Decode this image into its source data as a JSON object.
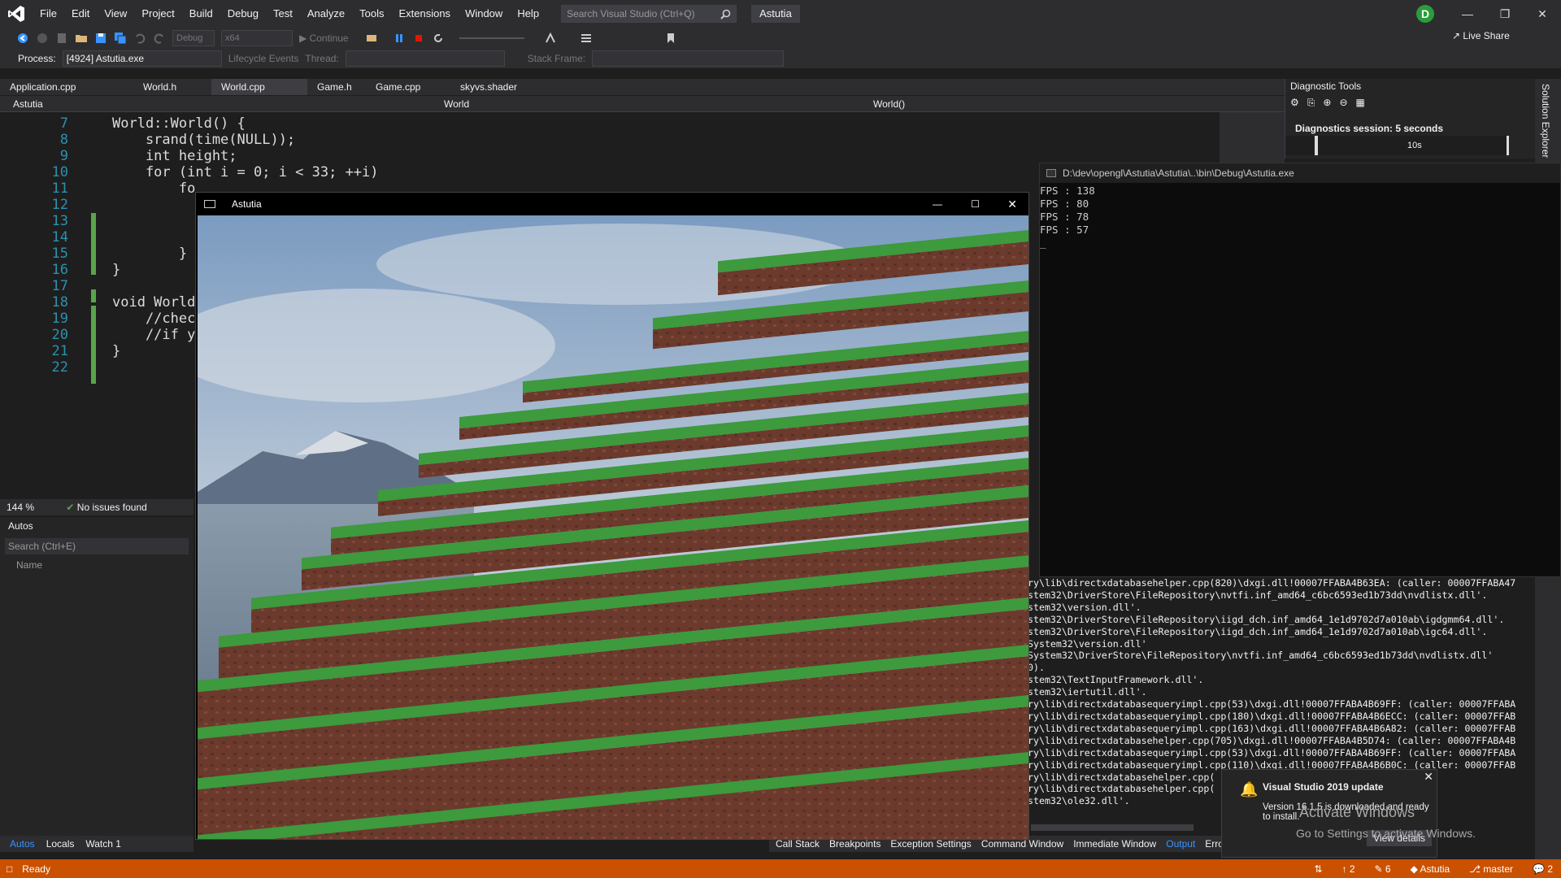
{
  "menubar": {
    "items": [
      "File",
      "Edit",
      "View",
      "Project",
      "Build",
      "Debug",
      "Test",
      "Analyze",
      "Tools",
      "Extensions",
      "Window",
      "Help"
    ],
    "search_placeholder": "Search Visual Studio (Ctrl+Q)",
    "solution_name": "Astutia",
    "avatar_initial": "D"
  },
  "toolbar": {
    "config": "Debug",
    "platform": "x64",
    "continue_label": "Continue",
    "live_share": "Live Share"
  },
  "procbar": {
    "process_label": "Process:",
    "process_value": "[4924] Astutia.exe",
    "lifecycle": "Lifecycle Events",
    "thread_label": "Thread:",
    "stackframe_label": "Stack Frame:"
  },
  "tabs": [
    {
      "label": "Application.cpp",
      "active": false
    },
    {
      "label": "World.h",
      "active": false
    },
    {
      "label": "World.cpp",
      "active": true
    },
    {
      "label": "Game.h",
      "active": false
    },
    {
      "label": "Game.cpp",
      "active": false
    },
    {
      "label": "skyvs.shader",
      "active": false
    }
  ],
  "navbar": {
    "project": "Astutia",
    "scope": "World",
    "member": "World()"
  },
  "editor": {
    "lines": [
      {
        "n": "7",
        "code": "World::World() {"
      },
      {
        "n": "8",
        "code": "    srand(time(NULL));"
      },
      {
        "n": "9",
        "code": "    int height;"
      },
      {
        "n": "10",
        "code": "    for (int i = 0; i < 33; ++i)"
      },
      {
        "n": "11",
        "code": "        fo"
      },
      {
        "n": "12",
        "code": ""
      },
      {
        "n": "13",
        "code": ""
      },
      {
        "n": "14",
        "code": ""
      },
      {
        "n": "15",
        "code": "        }"
      },
      {
        "n": "16",
        "code": "}"
      },
      {
        "n": "17",
        "code": ""
      },
      {
        "n": "18",
        "code": "void World"
      },
      {
        "n": "19",
        "code": "    //chec"
      },
      {
        "n": "20",
        "code": "    //if y"
      },
      {
        "n": "21",
        "code": "}"
      },
      {
        "n": "22",
        "code": ""
      }
    ],
    "zoom": "144 %",
    "issues": "No issues found"
  },
  "autos": {
    "title": "Autos",
    "search_placeholder": "Search (Ctrl+E)",
    "col_name": "Name",
    "tabs": [
      "Autos",
      "Locals",
      "Watch 1"
    ]
  },
  "bottom_tabs": [
    "Call Stack",
    "Breakpoints",
    "Exception Settings",
    "Command Window",
    "Immediate Window",
    "Output",
    "Erro"
  ],
  "diag": {
    "title": "Diagnostic Tools",
    "session": "Diagnostics session: 5 seconds",
    "tick": "10s"
  },
  "solution_explorer": "Solution Explorer",
  "console": {
    "title": "D:\\dev\\opengl\\Astutia\\Astutia\\..\\bin\\Debug\\Astutia.exe",
    "lines": [
      "FPS : 138",
      "FPS : 80",
      "FPS : 78",
      "FPS : 57",
      "_"
    ]
  },
  "game": {
    "title": "Astutia"
  },
  "output_lines": [
    "ry\\lib\\directxdatabasehelper.cpp(820)\\dxgi.dll!00007FFABA4B63EA: (caller: 00007FFABA47",
    "stem32\\DriverStore\\FileRepository\\nvtfi.inf_amd64_c6bc6593ed1b73dd\\nvdlistx.dll'.",
    "stem32\\version.dll'.",
    "stem32\\DriverStore\\FileRepository\\iigd_dch.inf_amd64_1e1d9702d7a010ab\\igdgmm64.dll'.",
    "stem32\\DriverStore\\FileRepository\\iigd_dch.inf_amd64_1e1d9702d7a010ab\\igc64.dll'.",
    "System32\\version.dll'",
    "System32\\DriverStore\\FileRepository\\nvtfi.inf_amd64_c6bc6593ed1b73dd\\nvdlistx.dll'",
    "0).",
    "stem32\\TextInputFramework.dll'.",
    "stem32\\iertutil.dll'.",
    "ry\\lib\\directxdatabasequeryimpl.cpp(53)\\dxgi.dll!00007FFABA4B69FF: (caller: 00007FFABA",
    "ry\\lib\\directxdatabasequeryimpl.cpp(180)\\dxgi.dll!00007FFABA4B6ECC: (caller: 00007FFAB",
    "ry\\lib\\directxdatabasequeryimpl.cpp(163)\\dxgi.dll!00007FFABA4B6A82: (caller: 00007FFAB",
    "ry\\lib\\directxdatabasehelper.cpp(705)\\dxgi.dll!00007FFABA4B5D74: (caller: 00007FFABA4B",
    "ry\\lib\\directxdatabasequeryimpl.cpp(53)\\dxgi.dll!00007FFABA4B69FF: (caller: 00007FFABA",
    "ry\\lib\\directxdatabasequeryimpl.cpp(110)\\dxgi.dll!00007FFABA4B6B0C: (caller: 00007FFAB",
    "ry\\lib\\directxdatabasehelper.cpp(",
    "ry\\lib\\directxdatabasehelper.cpp(",
    "stem32\\ole32.dll'."
  ],
  "notification": {
    "title": "Visual Studio 2019 update",
    "body": "Version 16.1.5 is downloaded and ready to install.",
    "button": "View details"
  },
  "activate": {
    "line1": "Activate Windows",
    "line2": "Go to Settings to activate Windows."
  },
  "statusbar": {
    "ready": "Ready",
    "up_count": "2",
    "pencil_count": "6",
    "repo": "Astutia",
    "branch": "master",
    "notif_count": "2"
  },
  "colors": {
    "status_bar": "#ca5100",
    "accent": "#007acc",
    "grass": "#3d9a3d",
    "dirt": "#6b3a2c"
  }
}
